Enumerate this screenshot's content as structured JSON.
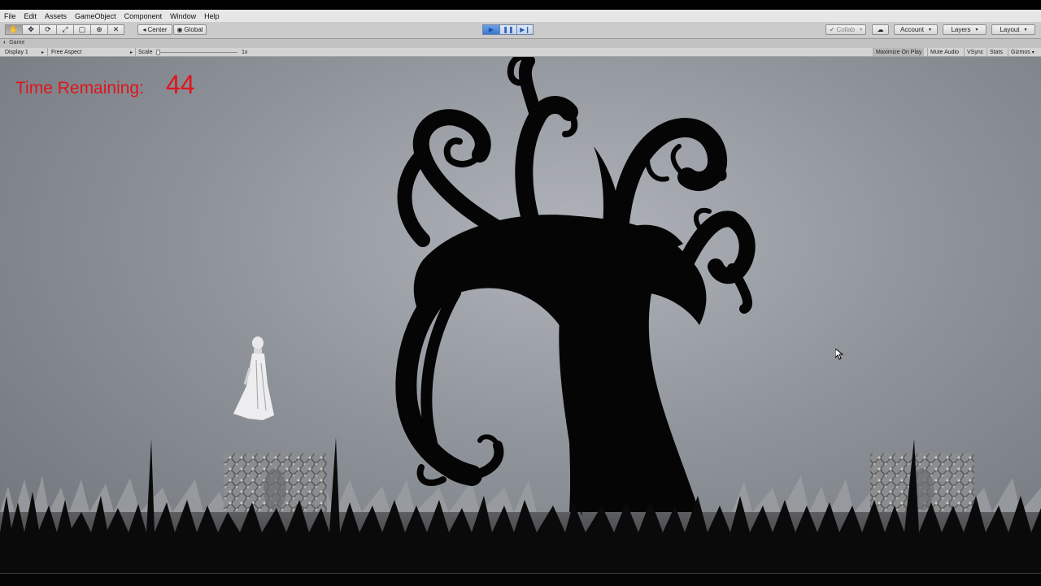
{
  "menu": [
    "File",
    "Edit",
    "Assets",
    "GameObject",
    "Component",
    "Window",
    "Help"
  ],
  "toolbar": {
    "tools": [
      "hand-icon",
      "move-icon",
      "rotate-icon",
      "scale-icon",
      "rect-icon",
      "transform-icon",
      "custom-tool-icon"
    ],
    "pivot_label": "Center",
    "space_label": "Global",
    "collab_label": "Collab",
    "account_label": "Account",
    "layers_label": "Layers",
    "layout_label": "Layout"
  },
  "game_tab": {
    "label": "Game"
  },
  "game_bar": {
    "display": "Display 1",
    "aspect": "Free Aspect",
    "scale_label": "Scale",
    "scale_value": "1x",
    "maximize": "Maximize On Play",
    "mute": "Mute Audio",
    "vsync": "VSync",
    "stats": "Stats",
    "gizmos": "Gizmos"
  },
  "hud": {
    "label": "Time Remaining:",
    "value": "44",
    "color": "#e0141e"
  }
}
